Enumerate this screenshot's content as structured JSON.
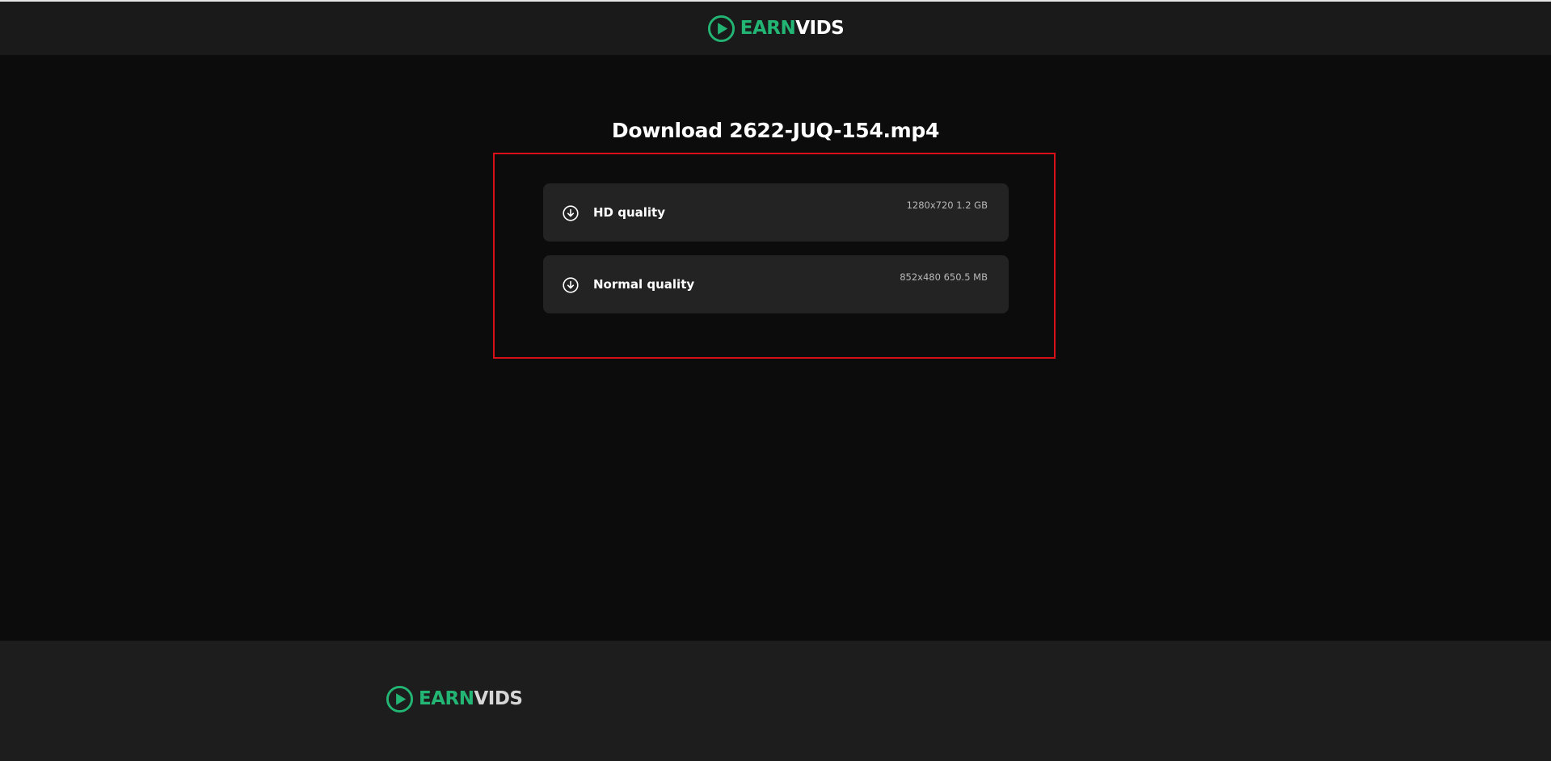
{
  "header": {
    "logo": {
      "icon": "play-circle-icon",
      "text_earn": "EARN",
      "text_vids": "VIDS"
    }
  },
  "main": {
    "title": "Download 2622-JUQ-154.mp4",
    "options": [
      {
        "label": "HD quality",
        "meta": "1280x720 1.2 GB",
        "icon": "download-circle-icon"
      },
      {
        "label": "Normal quality",
        "meta": "852x480 650.5 MB",
        "icon": "download-circle-icon"
      }
    ]
  },
  "footer": {
    "logo": {
      "icon": "play-circle-icon",
      "text_earn": "EARN",
      "text_vids": "VIDS"
    }
  },
  "colors": {
    "brand_green": "#22b573",
    "highlight_border": "#d8101a",
    "header_bg": "#1a1a1a",
    "page_bg": "#0c0c0c",
    "option_bg": "#232323",
    "footer_bg": "#1d1d1d"
  }
}
